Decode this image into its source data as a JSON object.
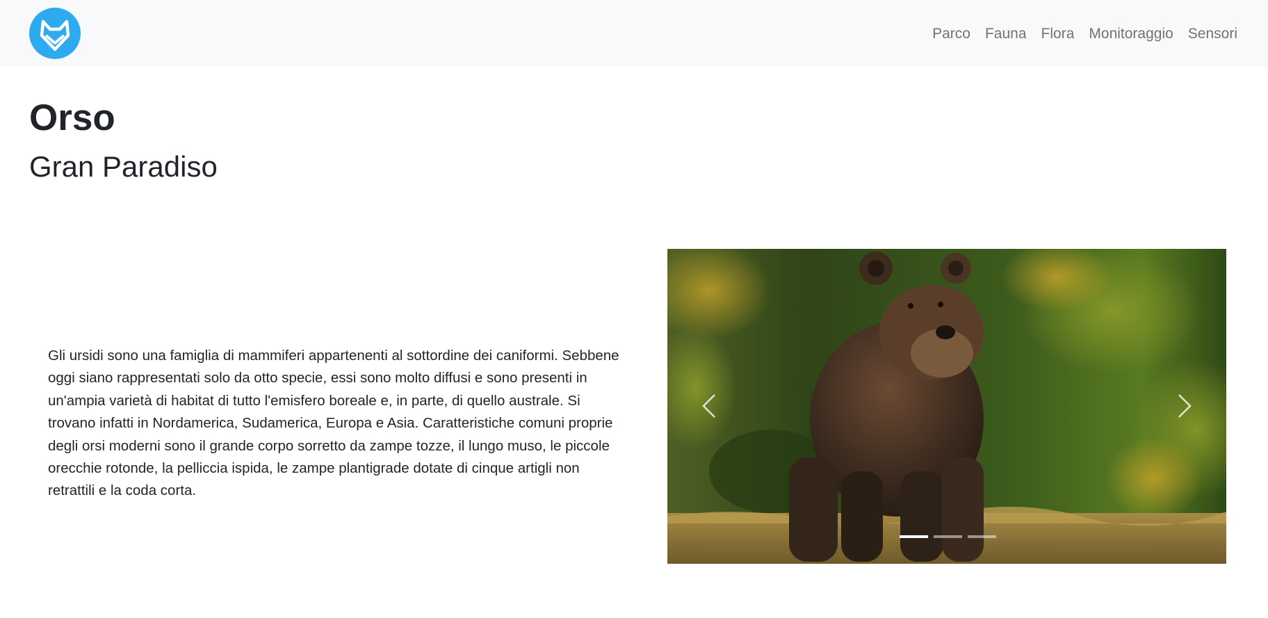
{
  "navbar": {
    "logo_icon": "fox-head-icon",
    "logo_color": "#2eaaf0",
    "links": [
      "Parco",
      "Fauna",
      "Flora",
      "Monitoraggio",
      "Sensori"
    ]
  },
  "page": {
    "title": "Orso",
    "subtitle": "Gran Paradiso",
    "description": "Gli ursidi sono una famiglia di mammiferi appartenenti al sottordine dei caniformi. Sebbene oggi siano rappresentati solo da otto specie, essi sono molto diffusi e sono presenti in un'ampia varietà di habitat di tutto l'emisfero boreale e, in parte, di quello australe. Si trovano infatti in Nordamerica, Sudamerica, Europa e Asia. Caratteristiche comuni proprie degli orsi moderni sono il grande corpo sorretto da zampe tozze, il lungo muso, le piccole orecchie rotonde, la pelliccia ispida, le zampe plantigrade dotate di cinque artigli non retrattili e la coda corta."
  },
  "carousel": {
    "slide_count": 3,
    "active_index": 0,
    "prev_icon": "chevron-left-icon",
    "next_icon": "chevron-right-icon"
  }
}
